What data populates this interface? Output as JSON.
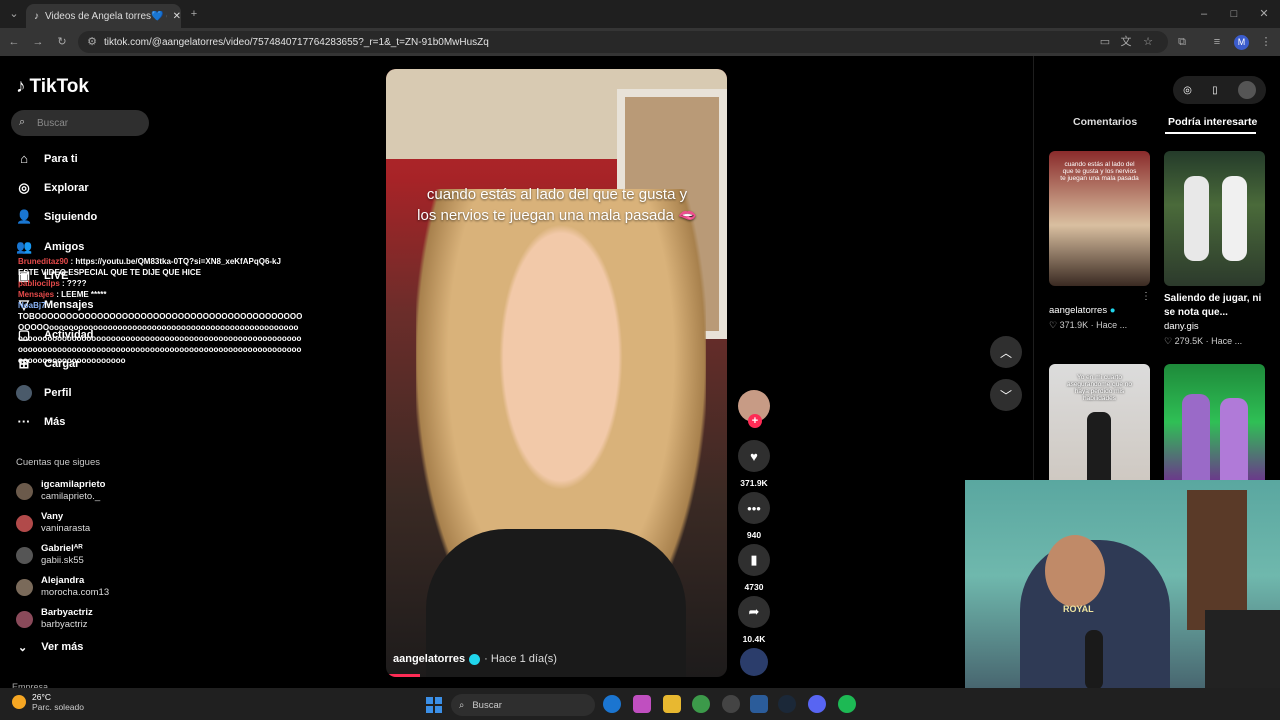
{
  "browser": {
    "tab_title": "Videos de Angela torres💙 (@a",
    "url": "tiktok.com/@aangelatorres/video/7574840717764283655?_r=1&_t=ZN-91b0MwHusZq"
  },
  "sidebar": {
    "logo": "TikTok",
    "search_placeholder": "Buscar",
    "nav": [
      {
        "label": "Para ti",
        "icon": "home-icon"
      },
      {
        "label": "Explorar",
        "icon": "compass-icon"
      },
      {
        "label": "Siguiendo",
        "icon": "following-icon"
      },
      {
        "label": "Amigos",
        "icon": "friends-icon"
      },
      {
        "label": "LIVE",
        "icon": "live-icon"
      },
      {
        "label": "Mensajes",
        "icon": "messages-icon"
      },
      {
        "label": "Actividad",
        "icon": "activity-icon"
      },
      {
        "label": "Cargar",
        "icon": "upload-icon"
      },
      {
        "label": "Perfil",
        "icon": "profile-avatar"
      },
      {
        "label": "Más",
        "icon": "more-icon"
      }
    ],
    "follows_title": "Cuentas que sigues",
    "follows": [
      {
        "name": "igcamilaprieto",
        "handle": "camilaprieto._"
      },
      {
        "name": "Vany",
        "handle": "vaninarasta"
      },
      {
        "name": "Gabrielᴬᴿ",
        "handle": "gabii.sk55"
      },
      {
        "name": "Alejandra",
        "handle": "morocha.com13"
      },
      {
        "name": "Barbyactriz",
        "handle": "barbyactriz"
      }
    ],
    "see_more": "Ver más",
    "footer_partial": "Empresa"
  },
  "chat": {
    "messages": [
      {
        "user": "Bruneditaz90",
        "text": ": https://youtu.be/QM83tka-0TQ?si=XN8_xeKfAPqQ6-kJ ESTE VIDEO ESPECIAL QUE TE DIJE QUE HICE"
      },
      {
        "user": "pabliocilps",
        "text": ": ????"
      },
      {
        "user": "Mensajes",
        "text": ": LEEME *****"
      },
      {
        "user": "NoaBj7",
        "text": ":"
      },
      {
        "user": "",
        "text": "TOBOOOOOOOOOOOOOOOOOOOOOOOOOOOOOOOOOOOOOOOOOOOOOOOOooooooooooooooooooooooooooooooooooooooooooooooooooooooooooooooooooooooooooooooooooooooooooooooooooooooooooooooooooooooooooooooooooooooooooooooooooooooooooooooooooooooooooooooooooooooooooooo"
      }
    ]
  },
  "video": {
    "caption": "cuando estás al lado del que te gusta y los nervios te juegan una mala pasada 🫦",
    "author": "aangelatorres",
    "time": "· Hace 1 día(s)"
  },
  "actions": {
    "likes": "371.9K",
    "comments": "940",
    "saves": "4730",
    "shares": "10.4K"
  },
  "right_panel": {
    "tabs": [
      "Comentarios",
      "Podría interesarte"
    ],
    "items": [
      {
        "thumb_text": "cuando estás al lado del que te gusta y los nervios te juegan una mala pasada",
        "title": "",
        "author": "aangelatorres",
        "likes": "371.9K",
        "time": "· Hace ..."
      },
      {
        "thumb_text": "",
        "title": "Saliendo de jugar, ni se nota que...",
        "author": "dany.gis",
        "likes": "279.5K",
        "time": "· Hace ..."
      },
      {
        "thumb_text": "Yo en mi cuarto asegurandome que no haya perdido mis habilidades",
        "title": "",
        "author": "",
        "likes": "",
        "time": ""
      },
      {
        "thumb_text": "",
        "title": "",
        "author": "",
        "likes": "",
        "time": ""
      }
    ]
  },
  "webcam": {
    "shirt_text": "ROYAL"
  },
  "taskbar": {
    "weather_temp": "26°C",
    "weather_desc": "Parc. soleado",
    "search": "Buscar"
  },
  "colors": {
    "accent": "#fe2c55",
    "verified": "#20d5ec",
    "background": "#000000"
  }
}
